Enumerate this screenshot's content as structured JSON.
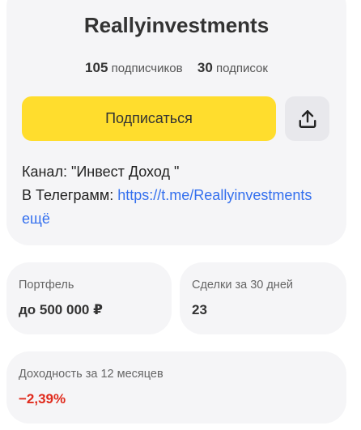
{
  "profile": {
    "name": "Reallyinvestments",
    "subscribers_count": "105",
    "subscribers_label": "подписчиков",
    "subscriptions_count": "30",
    "subscriptions_label": "подписок",
    "subscribe_label": "Подписаться",
    "share_icon": "share-upload-icon",
    "description_line1": "Канал: \"Инвест Доход \"",
    "description_line2_prefix": "В Телеграмм: ",
    "description_link": "https://t.me/Reallyinvestments",
    "more_label": "ещё"
  },
  "stats": {
    "portfolio_label": "Портфель",
    "portfolio_value": "до 500 000 ₽",
    "deals_label": "Сделки за 30 дней",
    "deals_value": "23",
    "yield_label": "Доходность за 12 месяцев",
    "yield_value": "−2,39%"
  },
  "colors": {
    "accent_yellow": "#ffdd2d",
    "link_blue": "#336fee",
    "negative_red": "#e02b1d",
    "card_bg": "#f5f5f7"
  }
}
